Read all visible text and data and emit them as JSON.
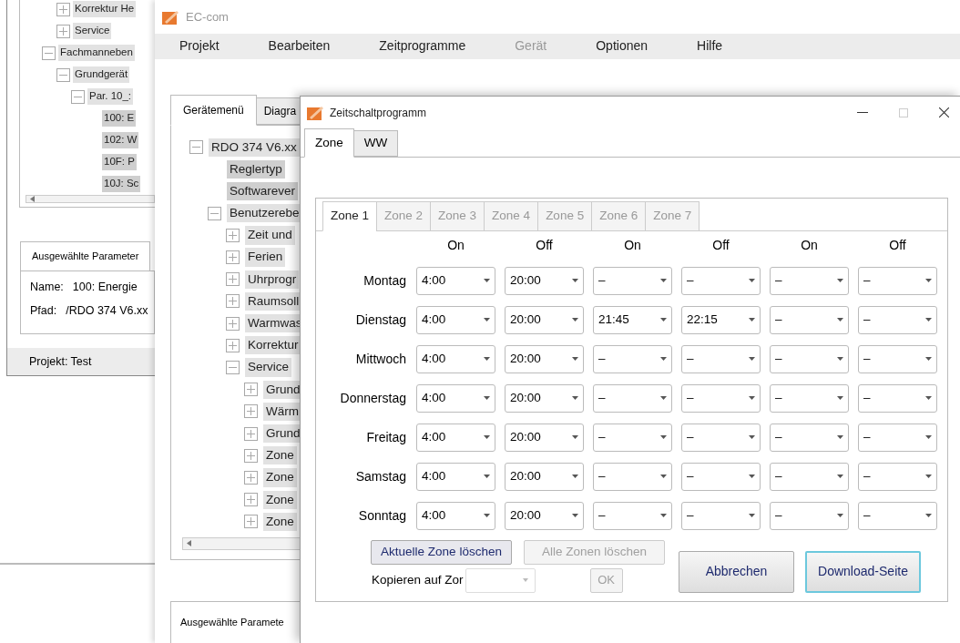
{
  "back_window": {
    "tree": [
      {
        "children": [
          {
            "label": "Korrektur He",
            "expanded": false
          },
          {
            "label": "Service",
            "expanded": false
          }
        ]
      },
      {
        "label": "Fachmanneben",
        "expanded": true,
        "children": [
          {
            "label": "Grundgerät",
            "expanded": true,
            "children": [
              {
                "label": "Par. 10_:",
                "expanded": true,
                "children": [
                  {
                    "label": "100: E"
                  },
                  {
                    "label": "102: W"
                  },
                  {
                    "label": "10F: P"
                  },
                  {
                    "label": "10J: Sc"
                  }
                ]
              }
            ]
          }
        ]
      }
    ],
    "parameter_tab": "Ausgewählte Parameter",
    "parameter_fields": [
      {
        "label": "Name:",
        "value": "100: Energie"
      },
      {
        "label": "Pfad:",
        "value": "/RDO 374 V6.xx"
      }
    ],
    "status_bar": "Projekt: Test"
  },
  "main_window": {
    "title": "EC-com",
    "menu": [
      {
        "label": "Projekt",
        "disabled": false
      },
      {
        "label": "Bearbeiten",
        "disabled": false
      },
      {
        "label": "Zeitprogramme",
        "disabled": false
      },
      {
        "label": "Gerät",
        "disabled": true
      },
      {
        "label": "Optionen",
        "disabled": false
      },
      {
        "label": "Hilfe",
        "disabled": false
      }
    ],
    "tabs": [
      {
        "label": "Gerätemenü",
        "selected": true
      },
      {
        "label": "Diagra",
        "selected": false
      }
    ],
    "tree": [
      {
        "label": "RDO 374 V6.xx",
        "expanded": true,
        "children": [
          {
            "label": "Reglertyp"
          },
          {
            "label": "Softwarever"
          },
          {
            "label": "Benutzerebe",
            "expanded": true,
            "children": [
              {
                "label": "Zeit und",
                "expanded": false
              },
              {
                "label": "Ferien",
                "expanded": false
              },
              {
                "label": "Uhrprogr",
                "expanded": false
              },
              {
                "label": "Raumsoll",
                "expanded": false
              },
              {
                "label": "Warmwas",
                "expanded": false
              },
              {
                "label": "Korrektur",
                "expanded": false
              },
              {
                "label": "Service",
                "expanded": true,
                "children": [
                  {
                    "label": "Grund",
                    "expanded": false
                  },
                  {
                    "label": "Wärm",
                    "expanded": false
                  },
                  {
                    "label": "Grund",
                    "expanded": false
                  },
                  {
                    "label": "Zone",
                    "expanded": false
                  },
                  {
                    "label": "Zone",
                    "expanded": false
                  },
                  {
                    "label": "Zone",
                    "expanded": false
                  },
                  {
                    "label": "Zone",
                    "expanded": false
                  }
                ]
              }
            ]
          }
        ]
      }
    ],
    "parameter_tab": "Ausgewählte Paramete"
  },
  "dialog": {
    "title": "Zeitschaltprogramm",
    "tabs": [
      {
        "label": "Zone",
        "selected": true
      },
      {
        "label": "WW",
        "selected": false
      }
    ],
    "zone_tabs": [
      {
        "label": "Zone 1",
        "selected": true
      },
      {
        "label": "Zone 2",
        "selected": false
      },
      {
        "label": "Zone 3",
        "selected": false
      },
      {
        "label": "Zone 4",
        "selected": false
      },
      {
        "label": "Zone 5",
        "selected": false
      },
      {
        "label": "Zone 6",
        "selected": false
      },
      {
        "label": "Zone 7",
        "selected": false
      }
    ],
    "columns": [
      "On",
      "Off",
      "On",
      "Off",
      "On",
      "Off"
    ],
    "rows": [
      {
        "day": "Montag",
        "times": [
          "4:00",
          "20:00",
          "–",
          "–",
          "–",
          "–"
        ]
      },
      {
        "day": "Dienstag",
        "times": [
          "4:00",
          "20:00",
          "21:45",
          "22:15",
          "–",
          "–"
        ]
      },
      {
        "day": "Mittwoch",
        "times": [
          "4:00",
          "20:00",
          "–",
          "–",
          "–",
          "–"
        ]
      },
      {
        "day": "Donnerstag",
        "times": [
          "4:00",
          "20:00",
          "–",
          "–",
          "–",
          "–"
        ]
      },
      {
        "day": "Freitag",
        "times": [
          "4:00",
          "20:00",
          "–",
          "–",
          "–",
          "–"
        ]
      },
      {
        "day": "Samstag",
        "times": [
          "4:00",
          "20:00",
          "–",
          "–",
          "–",
          "–"
        ]
      },
      {
        "day": "Sonntag",
        "times": [
          "4:00",
          "20:00",
          "–",
          "–",
          "–",
          "–"
        ]
      }
    ],
    "clear_buttons": [
      {
        "label": "Aktuelle Zone löschen",
        "disabled": false
      },
      {
        "label": "Alle Zonen löschen",
        "disabled": true
      }
    ],
    "copy": {
      "label": "Kopieren auf Zor",
      "disabled": true,
      "ok": "OK"
    },
    "actions": [
      {
        "label": "Abbrechen",
        "focused": false
      },
      {
        "label": "Download-Seite",
        "focused": true
      }
    ]
  }
}
